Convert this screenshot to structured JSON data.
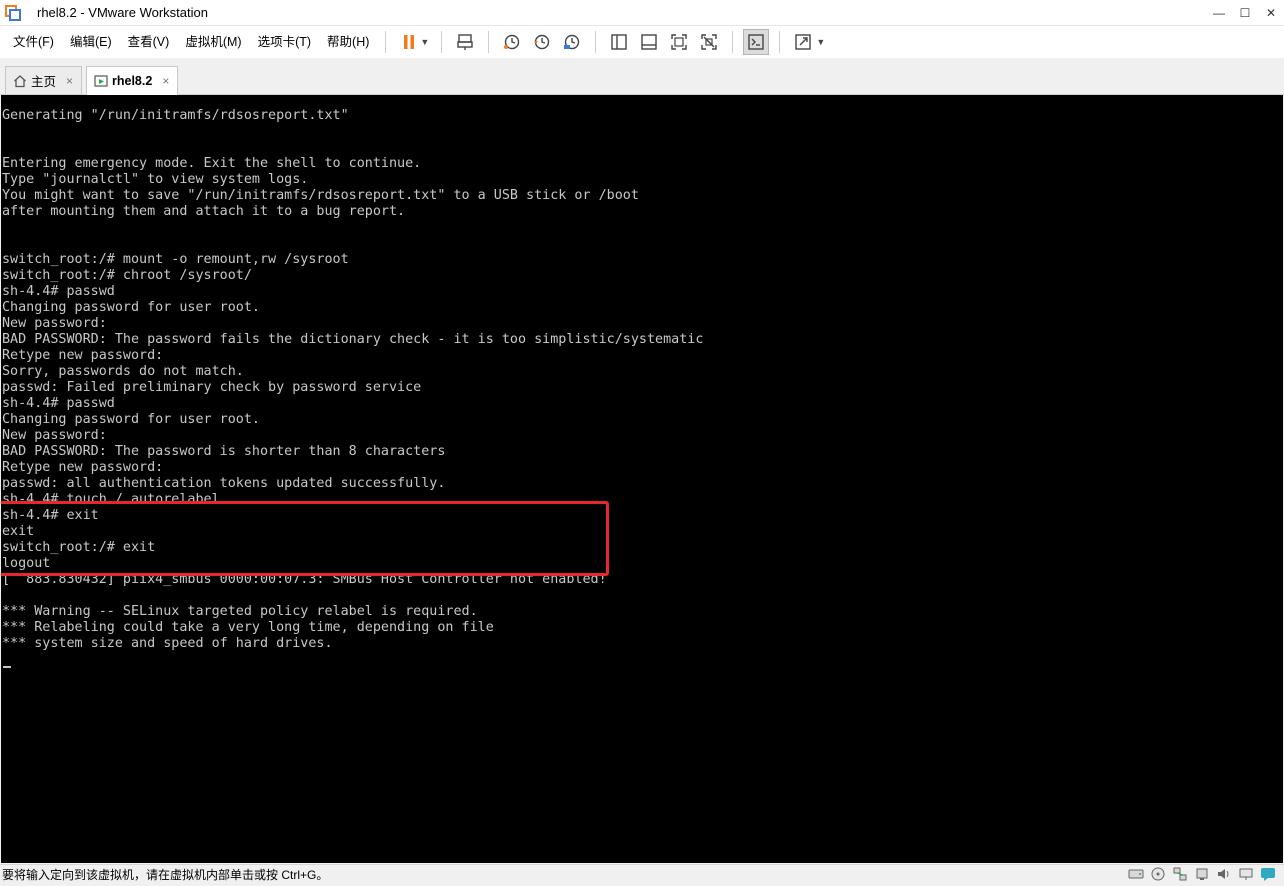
{
  "window": {
    "title": "rhel8.2 - VMware Workstation",
    "controls": [
      "—",
      "☐",
      "✕"
    ]
  },
  "menu": {
    "items": [
      "文件(F)",
      "编辑(E)",
      "查看(V)",
      "虚拟机(M)",
      "选项卡(T)",
      "帮助(H)"
    ]
  },
  "tabs": [
    {
      "label": "主页",
      "close": "×"
    },
    {
      "label": "rhel8.2",
      "close": "×"
    }
  ],
  "console": {
    "lines": [
      "Generating \"/run/initramfs/rdsosreport.txt\"",
      "",
      "",
      "Entering emergency mode. Exit the shell to continue.",
      "Type \"journalctl\" to view system logs.",
      "You might want to save \"/run/initramfs/rdsosreport.txt\" to a USB stick or /boot",
      "after mounting them and attach it to a bug report.",
      "",
      "",
      "switch_root:/# mount -o remount,rw /sysroot",
      "switch_root:/# chroot /sysroot/",
      "sh-4.4# passwd",
      "Changing password for user root.",
      "New password:",
      "BAD PASSWORD: The password fails the dictionary check - it is too simplistic/systematic",
      "Retype new password:",
      "Sorry, passwords do not match.",
      "passwd: Failed preliminary check by password service",
      "sh-4.4# passwd",
      "Changing password for user root.",
      "New password:",
      "BAD PASSWORD: The password is shorter than 8 characters",
      "Retype new password:",
      "passwd: all authentication tokens updated successfully.",
      "sh-4.4# touch /.autorelabel",
      "sh-4.4# exit",
      "exit",
      "switch_root:/# exit",
      "logout",
      "[  883.830432] piix4_smbus 0000:00:07.3: SMBus Host Controller not enabled!",
      "",
      "*** Warning -- SELinux targeted policy relabel is required.",
      "*** Relabeling could take a very long time, depending on file",
      "*** system size and speed of hard drives."
    ]
  },
  "status": {
    "message": "要将输入定向到该虚拟机，请在虚拟机内部单击或按 Ctrl+G。"
  },
  "colors": {
    "highlight": "#e8262d",
    "pause_icon": "#f07c1d",
    "console_bg": "#000000",
    "console_fg": "#c8c8c8"
  }
}
